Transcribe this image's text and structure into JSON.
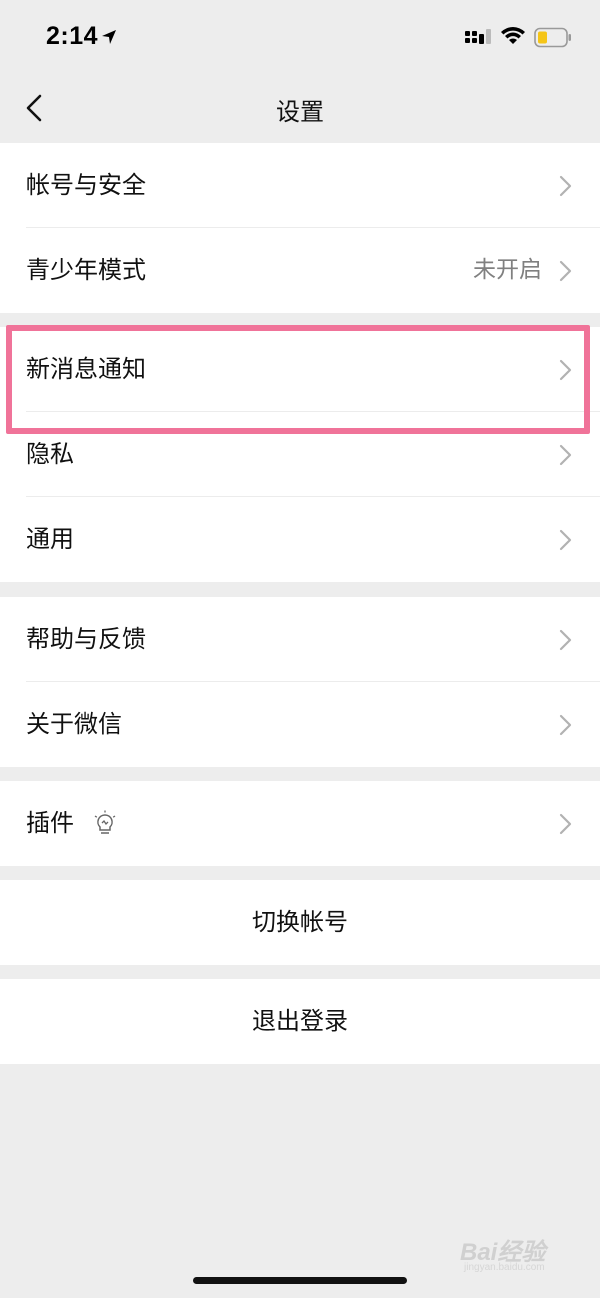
{
  "status_bar": {
    "time": "2:14",
    "battery_color": "#f5c518"
  },
  "nav": {
    "title": "设置",
    "back_icon": "chevron-left-icon"
  },
  "groups": [
    {
      "items": [
        {
          "label": "帐号与安全"
        },
        {
          "label": "青少年模式",
          "value": "未开启"
        }
      ]
    },
    {
      "items": [
        {
          "label": "新消息通知",
          "highlighted": true
        },
        {
          "label": "隐私"
        },
        {
          "label": "通用"
        }
      ]
    },
    {
      "items": [
        {
          "label": "帮助与反馈"
        },
        {
          "label": "关于微信"
        }
      ]
    },
    {
      "items": [
        {
          "label": "插件",
          "icon": "bulb-icon"
        }
      ]
    }
  ],
  "actions": {
    "switch_account": "切换帐号",
    "logout": "退出登录"
  },
  "watermark": {
    "text": "Bai经验",
    "sub": "jingyan.baidu.com"
  },
  "colors": {
    "highlight": "#f07399",
    "background": "#ededed",
    "secondary_text": "#808080"
  }
}
